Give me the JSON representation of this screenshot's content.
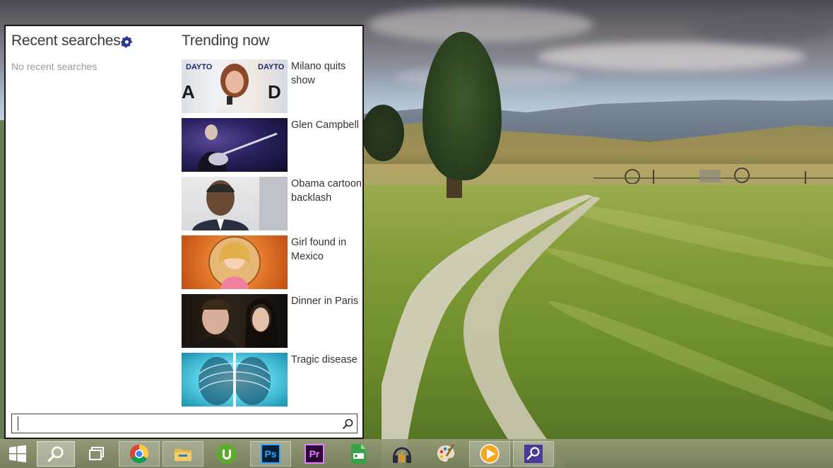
{
  "search_panel": {
    "recent_title": "Recent searches",
    "no_recent_text": "No recent searches",
    "trending_title": "Trending now",
    "trending": [
      {
        "label": "Milano quits show"
      },
      {
        "label": "Glen Campbell"
      },
      {
        "label": "Obama cartoon backlash"
      },
      {
        "label": "Girl found in Mexico"
      },
      {
        "label": "Dinner in Paris"
      },
      {
        "label": "Tragic disease"
      }
    ],
    "search_value": "",
    "search_placeholder": ""
  },
  "taskbar": {
    "items": [
      {
        "name": "start",
        "icon": "windows-logo-icon"
      },
      {
        "name": "search",
        "icon": "search-icon"
      },
      {
        "name": "task-view",
        "icon": "task-view-icon"
      },
      {
        "name": "chrome",
        "icon": "chrome-icon"
      },
      {
        "name": "file-explorer",
        "icon": "folder-icon"
      },
      {
        "name": "utorrent",
        "icon": "utorrent-icon"
      },
      {
        "name": "photoshop",
        "icon": "photoshop-icon",
        "text": "Ps"
      },
      {
        "name": "premiere",
        "icon": "premiere-icon",
        "text": "Pr"
      },
      {
        "name": "mp3-tool",
        "icon": "mp3-icon"
      },
      {
        "name": "audio-app",
        "icon": "headphones-icon"
      },
      {
        "name": "paint",
        "icon": "palette-icon"
      },
      {
        "name": "media-player",
        "icon": "play-icon"
      },
      {
        "name": "search-app",
        "icon": "magnifier-app-icon"
      }
    ]
  },
  "colors": {
    "panel_bg": "#ffffff",
    "heading_text": "#3a3a3a",
    "muted_text": "#9a9a9a",
    "gear_accent": "#2b3a8f",
    "photoshop": "#001e36",
    "premiere": "#2a0634"
  }
}
